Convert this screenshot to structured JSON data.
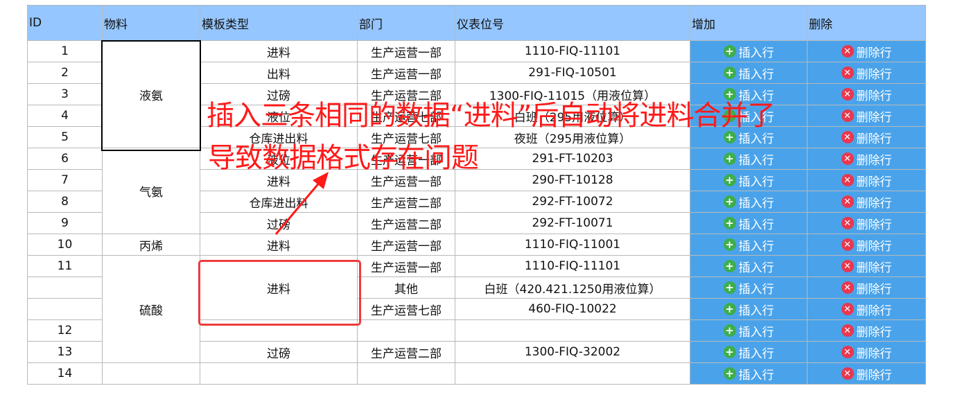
{
  "headers": [
    "ID",
    "物料",
    "模板类型",
    "部门",
    "仪表位号",
    "增加",
    "删除"
  ],
  "buttons": {
    "insert_label": "插入行",
    "delete_label": "删除行"
  },
  "icons": {
    "insert": "plus-circle-icon",
    "delete": "x-circle-icon"
  },
  "colors": {
    "header_bg": "#95c6ff",
    "button_bg": "#4aa3ea",
    "annotation": "#ff1a1a"
  },
  "rows": [
    {
      "id": "1",
      "material": "液氨",
      "template": "进料",
      "dept": "生产运营一部",
      "tag": "1110-FIQ-11101"
    },
    {
      "id": "2",
      "material": "",
      "template": "出料",
      "dept": "生产运营一部",
      "tag": "291-FIQ-10501"
    },
    {
      "id": "3",
      "material": "",
      "template": "过磅",
      "dept": "生产运营二部",
      "tag": "1300-FIQ-11015（用液位算）"
    },
    {
      "id": "4",
      "material": "",
      "template": "液位",
      "dept": "生产运营七部",
      "tag": "白班（295用液位算）"
    },
    {
      "id": "5",
      "material": "",
      "template": "仓库进出料",
      "dept": "生产运营七部",
      "tag": "夜班（295用液位算）"
    },
    {
      "id": "6",
      "material": "气氨",
      "template": "液位",
      "dept": "生产运营一部",
      "tag": "291-FT-10203"
    },
    {
      "id": "7",
      "material": "",
      "template": "进料",
      "dept": "生产运营一部",
      "tag": "290-FT-10128"
    },
    {
      "id": "8",
      "material": "",
      "template": "仓库进出料",
      "dept": "生产运营二部",
      "tag": "292-FT-10072"
    },
    {
      "id": "9",
      "material": "",
      "template": "过磅",
      "dept": "生产运营二部",
      "tag": "292-FT-10071"
    },
    {
      "id": "10",
      "material": "丙烯",
      "template": "进料",
      "dept": "生产运营一部",
      "tag": "1110-FIQ-11001"
    },
    {
      "id": "11",
      "material": "硫酸",
      "template": "进料",
      "dept": "生产运营一部",
      "tag": "1110-FIQ-11101"
    },
    {
      "id": "",
      "material": "",
      "template": "",
      "dept": "其他",
      "tag": "白班（420.421.1250用液位算）"
    },
    {
      "id": "",
      "material": "",
      "template": "",
      "dept": "生产运营七部",
      "tag": "460-FIQ-10022"
    },
    {
      "id": "12",
      "material": "",
      "template": "",
      "dept": "",
      "tag": ""
    },
    {
      "id": "13",
      "material": "",
      "template": "过磅",
      "dept": "生产运营二部",
      "tag": "1300-FIQ-32002"
    },
    {
      "id": "14",
      "material": "",
      "template": "",
      "dept": "",
      "tag": ""
    }
  ],
  "annotation": {
    "line1": "插入三条相同的数据“进料”后自动将进料合并了",
    "line2": "导致数据格式存在问题"
  }
}
